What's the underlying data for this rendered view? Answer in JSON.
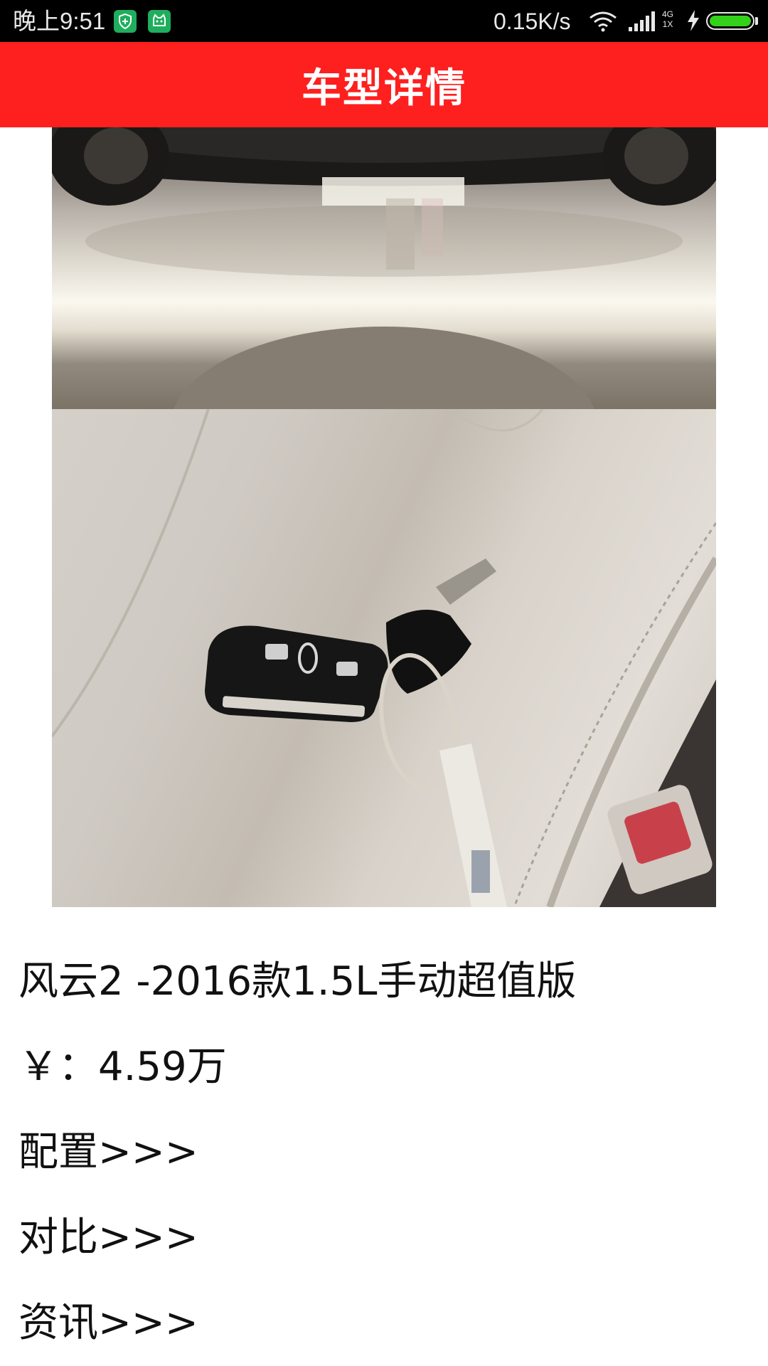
{
  "status_bar": {
    "time": "晚上9:51",
    "net_speed": "0.15K/s",
    "network_type_top": "4G",
    "network_type_bottom": "1X",
    "battery_level": 1.0,
    "colors": {
      "battery": "#34d11a",
      "app_icon": "#1fae5d"
    },
    "icons": [
      "shield-app-icon",
      "cat-app-icon",
      "wifi-icon",
      "signal-icon",
      "charging-icon",
      "battery-icon"
    ]
  },
  "header": {
    "title": "车型详情",
    "background": "#fe1f1f"
  },
  "gallery": {
    "images": [
      "car-underbody-photo",
      "car-key-on-seat-photo"
    ]
  },
  "detail": {
    "model_name": "风云2 -2016款1.5L手动超值版",
    "price": "￥：4.59万",
    "links": {
      "config": "配置>>>",
      "compare": "对比>>>",
      "news": "资讯>>>"
    }
  }
}
